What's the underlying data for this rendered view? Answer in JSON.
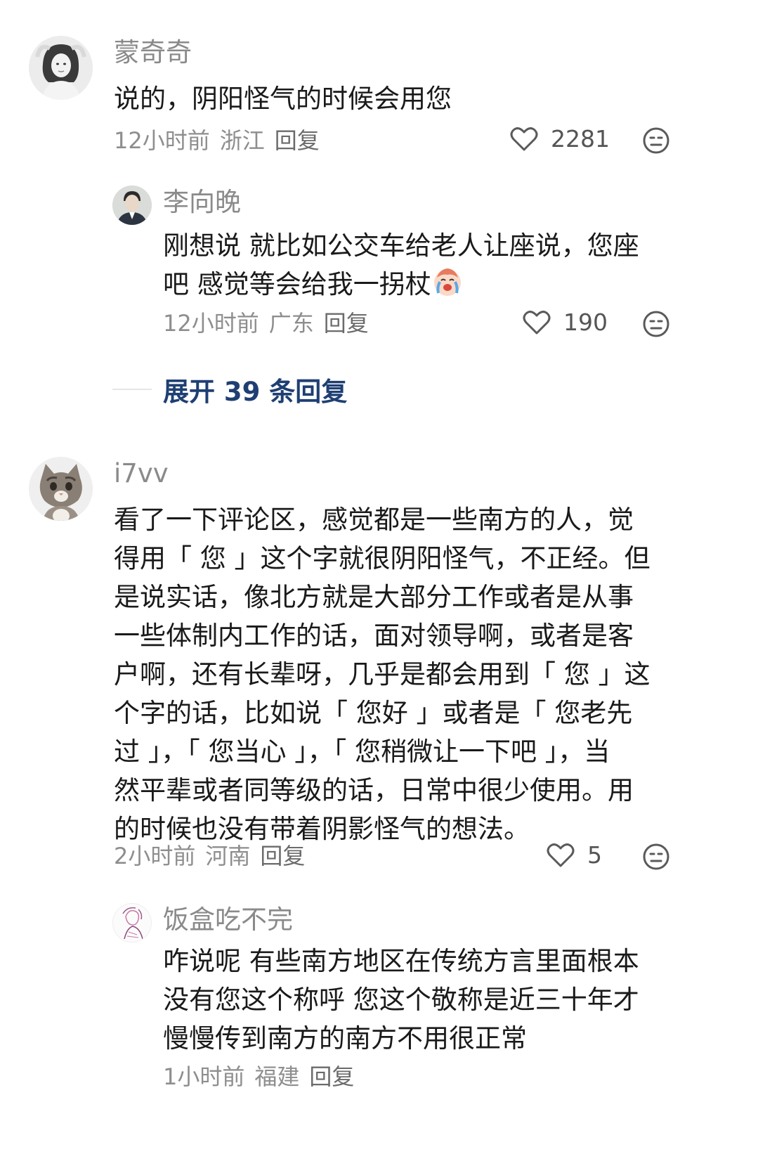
{
  "comments": [
    {
      "name": "蒙奇奇",
      "lines": [
        "说的，阴阳怪气的时候会用您"
      ],
      "time": "12小时前",
      "location": "浙江",
      "reply_label": "回复",
      "likes": "2281",
      "avatar_icon": "woman-portrait-avatar",
      "replies": [
        {
          "name": "李向晚",
          "lines": [
            "刚想说 就比如公交车给老人让座说，您座",
            "吧 感觉等会给我一拐杖"
          ],
          "emoji": "crying-face-emoji",
          "time": "12小时前",
          "location": "广东",
          "reply_label": "回复",
          "likes": "190",
          "avatar_icon": "man-uniform-avatar"
        }
      ],
      "expand_label": "展开 39 条回复"
    },
    {
      "name": "i7vv",
      "lines": [
        "看了一下评论区，感觉都是一些南方的人，觉",
        "得用「 您 」这个字就很阴阳怪气，不正经。但",
        "是说实话，像北方就是大部分工作或者是从事",
        "一些体制内工作的话，面对领导啊，或者是客",
        "户啊，还有长辈呀，几乎是都会用到「 您 」这",
        "个字的话，比如说「 您好 」或者是「 您老先",
        "过 」，「 您当心 」，「 您稍微让一下吧 」，当",
        "然平辈或者同等级的话，日常中很少使用。用",
        "的时候也没有带着阴影怪气的想法。"
      ],
      "time": "2小时前",
      "location": "河南",
      "reply_label": "回复",
      "likes": "5",
      "avatar_icon": "cat-avatar",
      "replies": [
        {
          "name": "饭盒吃不完",
          "lines": [
            "咋说呢 有些南方地区在传统方言里面根本",
            "没有您这个称呼 您这个敬称是近三十年才",
            "慢慢传到南方的南方不用很正常"
          ],
          "time": "1小时前",
          "location": "福建",
          "reply_label": "回复",
          "avatar_icon": "sketch-figure-avatar"
        }
      ]
    }
  ],
  "icons": {
    "like": "heart-outline-icon",
    "dislike": "neutral-face-icon"
  }
}
